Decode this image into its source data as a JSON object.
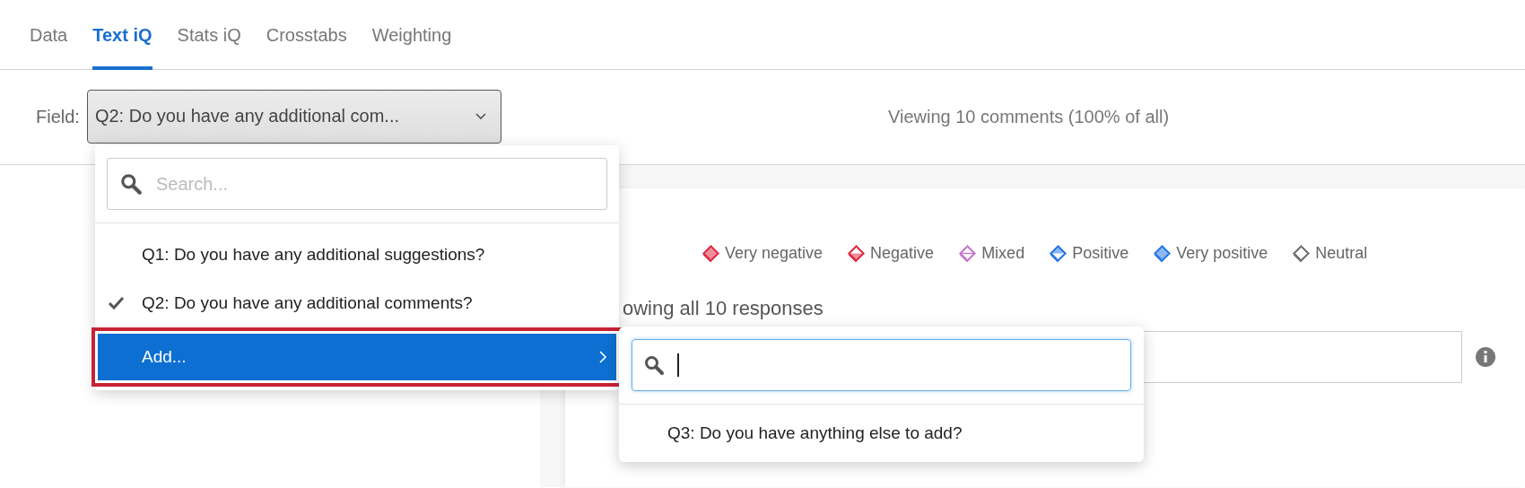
{
  "tabs": [
    {
      "label": "Data",
      "selected": false
    },
    {
      "label": "Text iQ",
      "selected": true
    },
    {
      "label": "Stats iQ",
      "selected": false
    },
    {
      "label": "Crosstabs",
      "selected": false
    },
    {
      "label": "Weighting",
      "selected": false
    }
  ],
  "field": {
    "label": "Field:",
    "value": "Q2: Do you have any additional com..."
  },
  "summary": "Viewing 10 comments (100% of all)",
  "legend": [
    {
      "label": "Very negative",
      "color": "#e0324a",
      "kind": "full"
    },
    {
      "label": "Negative",
      "color": "#e0324a",
      "kind": "lower"
    },
    {
      "label": "Mixed",
      "color": "#c77dd0",
      "kind": "line"
    },
    {
      "label": "Positive",
      "color": "#2f7be8",
      "kind": "upper"
    },
    {
      "label": "Very positive",
      "color": "#2f7be8",
      "kind": "full"
    },
    {
      "label": "Neutral",
      "color": "#757575",
      "kind": "none"
    }
  ],
  "responses_heading": "owing all 10 responses",
  "dropdown": {
    "search": {
      "placeholder": "Search..."
    },
    "items": [
      {
        "label": "Q1: Do you have any additional suggestions?",
        "checked": false,
        "selected": false,
        "kind": "option",
        "annotated": false
      },
      {
        "label": "Q2: Do you have any additional comments?",
        "checked": true,
        "selected": false,
        "kind": "option",
        "annotated": false
      },
      {
        "label": "Add...",
        "checked": false,
        "selected": true,
        "kind": "submenu",
        "annotated": true
      }
    ]
  },
  "submenu": {
    "search": {
      "focused": true
    },
    "items": [
      {
        "label": "Q3: Do you have anything else to add?"
      }
    ]
  }
}
